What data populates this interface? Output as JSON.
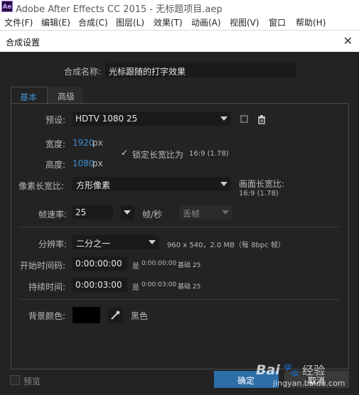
{
  "window": {
    "logo": "Ae",
    "title": "Adobe After Effects CC 2015 - 无标题项目.aep"
  },
  "menu": [
    "文件(F)",
    "编辑(E)",
    "合成(C)",
    "图层(L)",
    "效果(T)",
    "动画(A)",
    "视图(V)",
    "窗口",
    "帮助(H)"
  ],
  "dialog": {
    "title": "合成设置",
    "close": "✕",
    "comp_name_label": "合成名称:",
    "comp_name_value": "光标跟随的打字效果",
    "tabs": [
      "基本",
      "高级"
    ],
    "preset_label": "预设:",
    "preset_value": "HDTV 1080 25",
    "width_label": "宽度:",
    "width_value": "1920",
    "height_label": "高度:",
    "height_value": "1080",
    "unit_px": "px",
    "lock_checkbox": "✓",
    "lock_label": "锁定长宽比为",
    "lock_ratio": "16:9 (1.78)",
    "pixel_aspect_label": "像素长宽比:",
    "pixel_aspect_value": "方形像素",
    "frame_aspect_label": "画面长宽比:",
    "frame_aspect_value": "16:9 (1.78)",
    "fps_label": "帧速率:",
    "fps_value": "25",
    "fps_unit": "帧/秒",
    "drop_frame_value": "丢帧",
    "resolution_label": "分辨率:",
    "resolution_value": "二分之一",
    "resolution_info": "960 x 540，2.0 MB（每 8bpc 帧）",
    "start_tc_label": "开始时间码:",
    "start_tc_value": "0:00:00:00",
    "start_tc_info_is": "是",
    "start_tc_info_value": "0:00:00:00",
    "start_tc_info_base": "基础 25",
    "duration_label": "持续时间:",
    "duration_value": "0:00:03:00",
    "duration_info_is": "是",
    "duration_info_value": "0:00:03:00",
    "duration_info_base": "基础 25",
    "bg_color_label": "背景颜色:",
    "bg_color_name": "黑色",
    "bg_color_hex": "#000000",
    "preview_label": "预览",
    "ok_label": "确定",
    "cancel_label": "取消"
  },
  "watermark": {
    "brand": "Bai",
    "brand2": "经验",
    "url": "jingyan.baidu.com"
  },
  "colors": {
    "accent": "#3f8fd2",
    "ok_button": "#2c6ea6",
    "dialog_bg": "#232323"
  }
}
